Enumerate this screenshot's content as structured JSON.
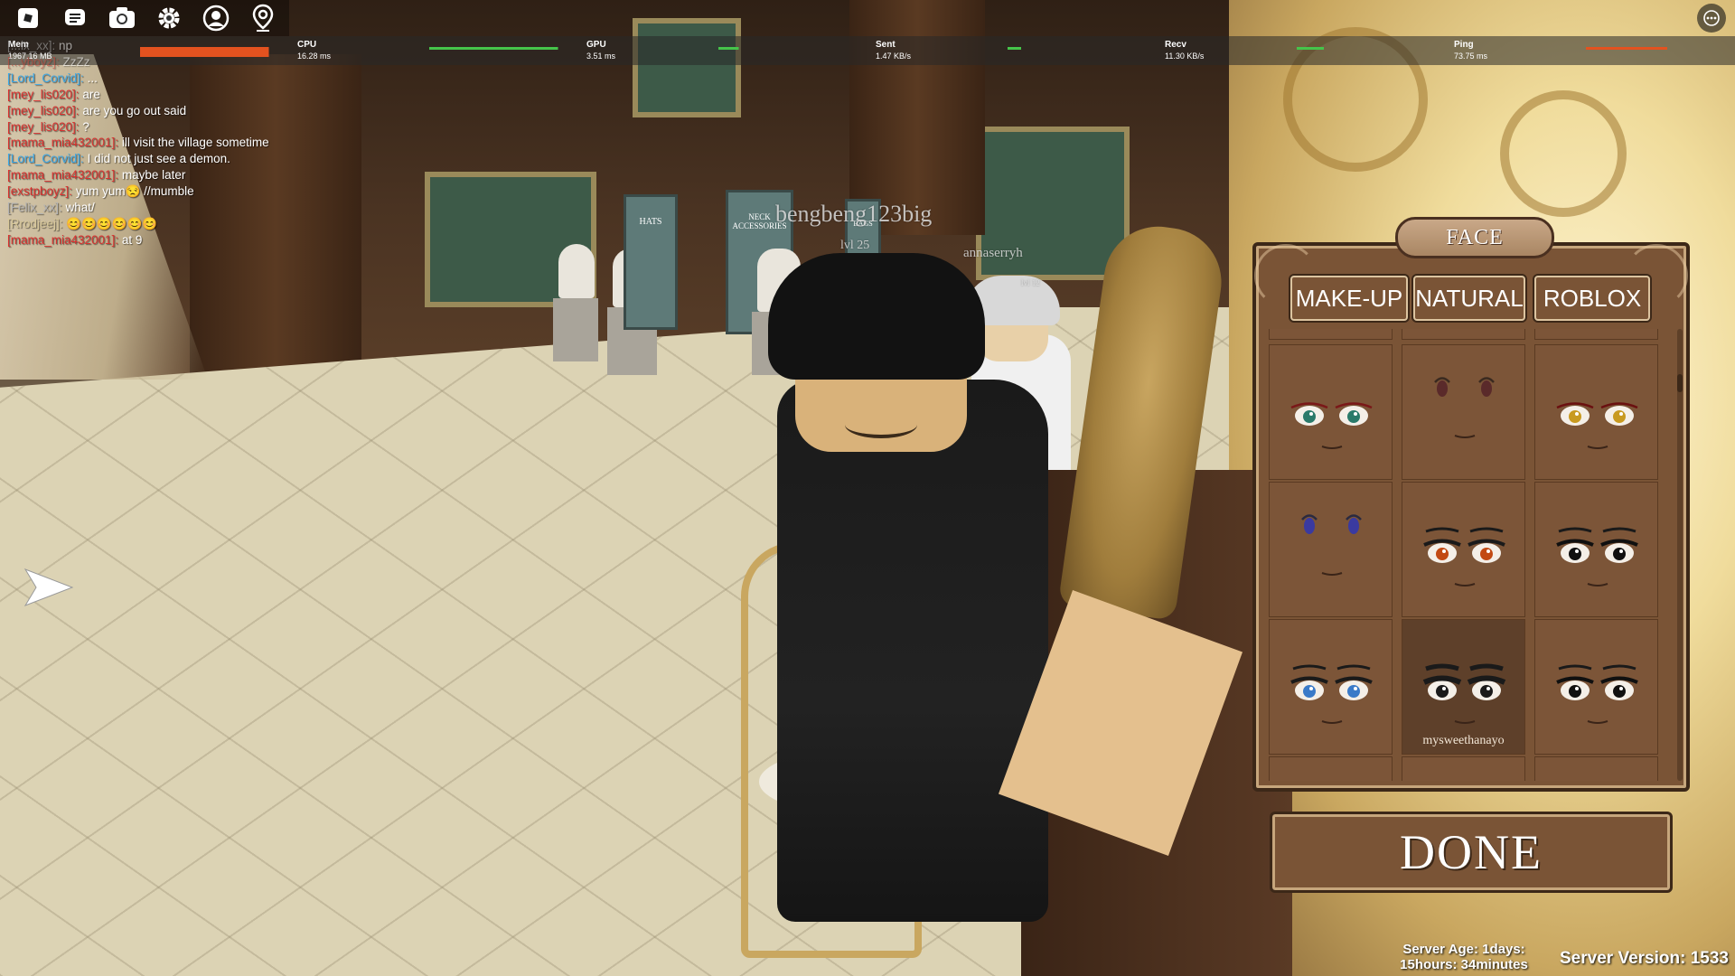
{
  "topbar": {
    "icons": [
      "roblox-logo-icon",
      "chat-icon",
      "camera-icon",
      "settings-icon",
      "avatar-icon",
      "location-icon"
    ],
    "more_icon": "more-options-icon"
  },
  "stats": [
    {
      "label": "Mem",
      "value": "1967.16 MB",
      "color": "#e3521f",
      "level": 0.95
    },
    {
      "label": "CPU",
      "value": "16.28 ms",
      "color": "#45c44a",
      "level": 0.95
    },
    {
      "label": "GPU",
      "value": "3.51 ms",
      "color": "#45c44a",
      "level": 0.15
    },
    {
      "label": "Sent",
      "value": "1.47 KB/s",
      "color": "#45c44a",
      "level": 0.1
    },
    {
      "label": "Recv",
      "value": "11.30 KB/s",
      "color": "#45c44a",
      "level": 0.2
    },
    {
      "label": "Ping",
      "value": "73.75 ms",
      "color": "#e3521f",
      "level": 0.6
    }
  ],
  "chat": [
    {
      "name": "[...ix_xx]:",
      "text": "np",
      "color": "#b4b4b4",
      "muted": true
    },
    {
      "name": "[...yboyz]:",
      "text": "ZzZz",
      "color": "#c63a2f",
      "muted": true
    },
    {
      "name": "[Lord_Corvid]:",
      "text": "...",
      "color": "#3aa8e8",
      "muted": false
    },
    {
      "name": "[mey_lis020]:",
      "text": "are",
      "color": "#d8312f",
      "muted": false
    },
    {
      "name": "[mey_lis020]:",
      "text": "are you go out said",
      "color": "#d8312f",
      "muted": false
    },
    {
      "name": "[mey_lis020]:",
      "text": "?",
      "color": "#d8312f",
      "muted": false
    },
    {
      "name": "[mama_mia432001]:",
      "text": "ill visit the village sometime",
      "color": "#d8312f",
      "muted": false
    },
    {
      "name": "[Lord_Corvid]:",
      "text": "I did not just see a demon.",
      "color": "#3aa8e8",
      "muted": false
    },
    {
      "name": "[mama_mia432001]:",
      "text": "maybe later",
      "color": "#d8312f",
      "muted": false
    },
    {
      "name": "[exstpboyz]:",
      "text": "yum yum😒 //mumble",
      "color": "#d8312f",
      "muted": false
    },
    {
      "name": "[Felix_xx]:",
      "text": "what/",
      "color": "#b4b4b4",
      "muted": false
    },
    {
      "name": "[Rrodjeej]:",
      "text": "😊😊😊😊😊😊",
      "color": "#d8c89a",
      "muted": false
    },
    {
      "name": "[mama_mia432001]:",
      "text": "at 9",
      "color": "#d8312f",
      "muted": false
    }
  ],
  "scene": {
    "player_name": "bengbeng123big",
    "player_level": "lvl 25",
    "npc_name": "annaserryh",
    "npc_sub": "lvl 12",
    "signs": [
      "HATS",
      "NECK ACCESSORIES",
      "BAGS"
    ]
  },
  "face_panel": {
    "title": "FACE",
    "tabs": [
      "MAKE-UP",
      "NATURAL",
      "ROBLOX"
    ],
    "items": [
      {
        "eye_color": "#2a7a6a",
        "lash": "#7a1818",
        "style": "anime",
        "caption": ""
      },
      {
        "eye_color": "#5a2a2a",
        "lash": "#3a2a20",
        "style": "small",
        "caption": ""
      },
      {
        "eye_color": "#c89a20",
        "lash": "#6a1010",
        "style": "anime",
        "caption": ""
      },
      {
        "eye_color": "#3a3aa0",
        "lash": "#2a2a40",
        "style": "small",
        "caption": ""
      },
      {
        "eye_color": "#c24a14",
        "lash": "#1a1a1a",
        "style": "bold",
        "caption": ""
      },
      {
        "eye_color": "#101010",
        "lash": "#101010",
        "style": "bold",
        "caption": ""
      },
      {
        "eye_color": "#3a7ac8",
        "lash": "#1a1a1a",
        "style": "bold",
        "caption": ""
      },
      {
        "eye_color": "#1a1a1a",
        "lash": "#1a1a1a",
        "style": "heavy",
        "caption": "mysweethanayo"
      },
      {
        "eye_color": "#101010",
        "lash": "#101010",
        "style": "bold",
        "caption": ""
      }
    ]
  },
  "done_label": "DONE",
  "server": {
    "age_line1": "Server Age: 1days:",
    "age_line2": "15hours: 34minutes",
    "version": "Server Version: 1533"
  }
}
